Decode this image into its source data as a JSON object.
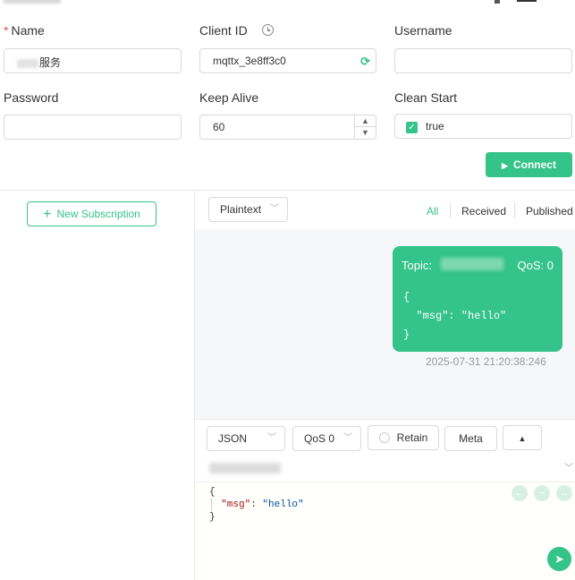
{
  "connection_form": {
    "name_label": "Name",
    "name_required_mark": "*",
    "name_value_visible": "服务",
    "client_id_label": "Client ID",
    "client_id_value": "mqttx_3e8ff3c0",
    "username_label": "Username",
    "username_value": "",
    "password_label": "Password",
    "password_value": "",
    "keep_alive_label": "Keep Alive",
    "keep_alive_value": "60",
    "clean_start_label": "Clean Start",
    "clean_start_value": "true",
    "connect_label": "Connect"
  },
  "subscriptions": {
    "new_subscription_label": "New Subscription"
  },
  "message_toolbar": {
    "format_value": "Plaintext",
    "filters": [
      "All",
      "Received",
      "Published"
    ],
    "active_filter": "All"
  },
  "message": {
    "topic_label": "Topic:",
    "qos_label": "QoS: 0",
    "payload_lines": [
      "{",
      "  \"msg\": \"hello\"",
      "}"
    ],
    "timestamp": "2025-07-31 21:20:38:246"
  },
  "composer": {
    "format_value": "JSON",
    "qos_value": "QoS 0",
    "retain_label": "Retain",
    "meta_label": "Meta",
    "payload_open": "{",
    "payload_key": "\"msg\"",
    "payload_colon": ": ",
    "payload_value": "\"hello\"",
    "payload_close": "}"
  },
  "colors": {
    "accent": "#34c388",
    "required": "#e2574c"
  },
  "icons": {
    "clock": "clock-icon",
    "refresh": "refresh-icon",
    "checkbox": "check-icon",
    "play": "play-icon",
    "plus": "plus-icon",
    "chevron": "chevron-down-icon",
    "send": "send-icon"
  }
}
